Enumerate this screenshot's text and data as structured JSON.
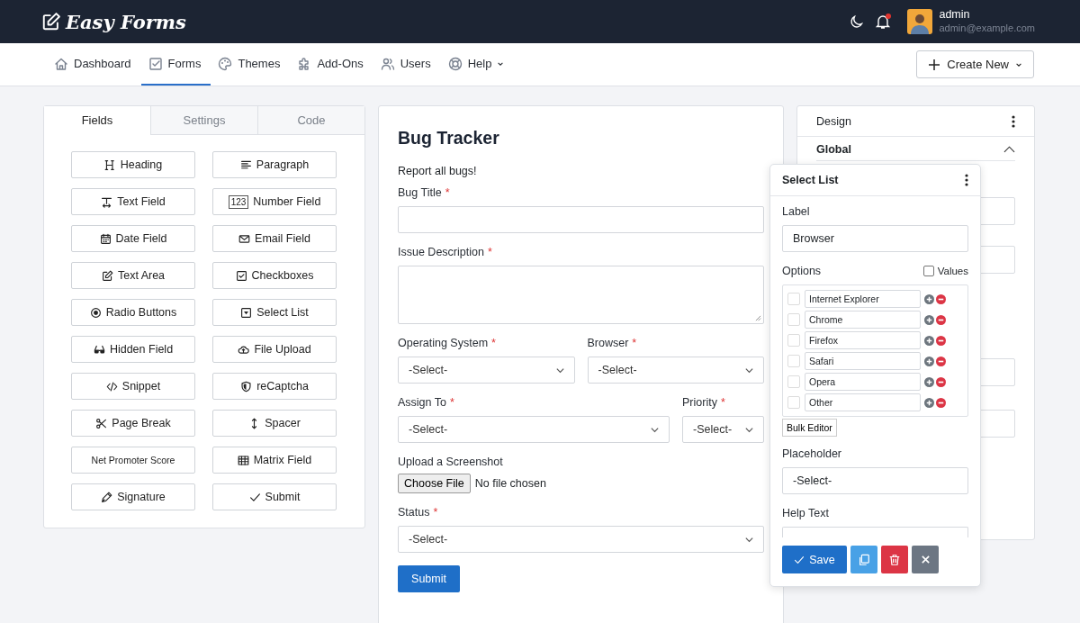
{
  "header": {
    "brand": "Easy Forms",
    "user": {
      "name": "admin",
      "email": "admin@example.com"
    }
  },
  "nav": {
    "items": [
      {
        "label": "Dashboard",
        "selected": false,
        "dropdown": false
      },
      {
        "label": "Forms",
        "selected": true,
        "dropdown": false
      },
      {
        "label": "Themes",
        "selected": false,
        "dropdown": false
      },
      {
        "label": "Add-Ons",
        "selected": false,
        "dropdown": false
      },
      {
        "label": "Users",
        "selected": false,
        "dropdown": false
      },
      {
        "label": "Help",
        "selected": false,
        "dropdown": true
      }
    ],
    "create_button": "Create New"
  },
  "builder": {
    "tabs": [
      {
        "label": "Fields",
        "selected": true
      },
      {
        "label": "Settings",
        "selected": false
      },
      {
        "label": "Code",
        "selected": false
      }
    ],
    "fields": [
      {
        "label": "Heading"
      },
      {
        "label": "Paragraph"
      },
      {
        "label": "Text Field"
      },
      {
        "label": "Number Field",
        "badge": "123"
      },
      {
        "label": "Date Field"
      },
      {
        "label": "Email Field"
      },
      {
        "label": "Text Area"
      },
      {
        "label": "Checkboxes"
      },
      {
        "label": "Radio Buttons"
      },
      {
        "label": "Select List"
      },
      {
        "label": "Hidden Field"
      },
      {
        "label": "File Upload"
      },
      {
        "label": "Snippet"
      },
      {
        "label": "reCaptcha"
      },
      {
        "label": "Page Break"
      },
      {
        "label": "Spacer"
      },
      {
        "label": "Net Promoter Score",
        "small": true
      },
      {
        "label": "Matrix Field"
      },
      {
        "label": "Signature"
      },
      {
        "label": "Submit"
      }
    ]
  },
  "form": {
    "title": "Bug Tracker",
    "description": "Report all bugs!",
    "rows": [
      [
        {
          "kind": "text",
          "label": "Bug Title",
          "required": true
        }
      ],
      [
        {
          "kind": "textarea",
          "label": "Issue Description",
          "required": true
        }
      ],
      [
        {
          "kind": "select",
          "label": "Operating System",
          "required": true,
          "value": "-Select-"
        },
        {
          "kind": "select",
          "label": "Browser",
          "required": true,
          "value": "-Select-"
        }
      ],
      [
        {
          "kind": "select",
          "label": "Assign To",
          "required": true,
          "value": "-Select-"
        },
        {
          "kind": "select",
          "label": "Priority",
          "required": true,
          "value": "-Select-"
        }
      ],
      [
        {
          "kind": "file",
          "label": "Upload a Screenshot",
          "required": false,
          "button": "Choose File",
          "value": "No file chosen"
        }
      ],
      [
        {
          "kind": "select",
          "label": "Status",
          "required": true,
          "value": "-Select-"
        }
      ]
    ],
    "required_mark": "*",
    "submit": "Submit"
  },
  "design": {
    "title": "Design",
    "section": "Global"
  },
  "popover": {
    "title": "Select List",
    "label_caption": "Label",
    "label_value": "Browser",
    "options_caption": "Options",
    "values_toggle": {
      "label": "Values",
      "checked": false
    },
    "options": [
      {
        "text": "Internet Explorer",
        "checked": false
      },
      {
        "text": "Chrome",
        "checked": false
      },
      {
        "text": "Firefox",
        "checked": false
      },
      {
        "text": "Safari",
        "checked": false
      },
      {
        "text": "Opera",
        "checked": false
      },
      {
        "text": "Other",
        "checked": false
      }
    ],
    "bulk_button": "Bulk Editor",
    "placeholder_caption": "Placeholder",
    "placeholder_value": "-Select-",
    "help_caption": "Help Text",
    "save_button": "Save"
  }
}
